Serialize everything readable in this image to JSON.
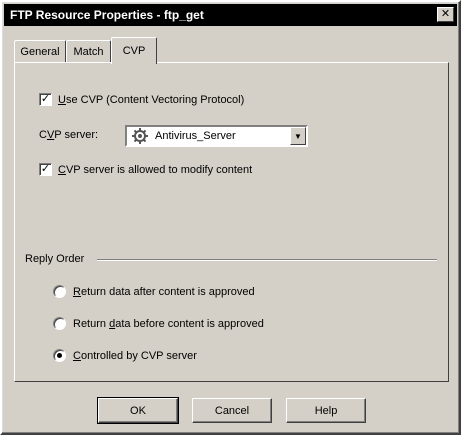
{
  "window": {
    "title": "FTP Resource Properties - ftp_get",
    "close_glyph": "✕"
  },
  "tabs": [
    {
      "label": "General",
      "active": false
    },
    {
      "label": "Match",
      "active": false
    },
    {
      "label": "CVP",
      "active": true
    }
  ],
  "cvp": {
    "use_cvp": {
      "label_u": "U",
      "label_rest": "se CVP (Content Vectoring Protocol)",
      "checked": true
    },
    "server_label_pre": "C",
    "server_label_u": "V",
    "server_label_post": "P server:",
    "server_value": "Antivirus_Server",
    "server_icon": "server-gear-icon",
    "modify": {
      "label_u": "C",
      "label_rest": "VP server is allowed to modify content",
      "checked": true
    }
  },
  "reply_order": {
    "title": "Reply Order",
    "options": [
      {
        "u": "R",
        "rest": "eturn data after content is approved",
        "pre": "",
        "selected": false
      },
      {
        "pre": "Return ",
        "u": "d",
        "rest": "ata before content is approved",
        "selected": false
      },
      {
        "pre": "",
        "u": "C",
        "rest": "ontrolled by CVP server",
        "selected": true
      }
    ]
  },
  "buttons": {
    "ok": "OK",
    "cancel": "Cancel",
    "help": "Help"
  },
  "check_glyph": "✓",
  "arrow_glyph": "▼"
}
